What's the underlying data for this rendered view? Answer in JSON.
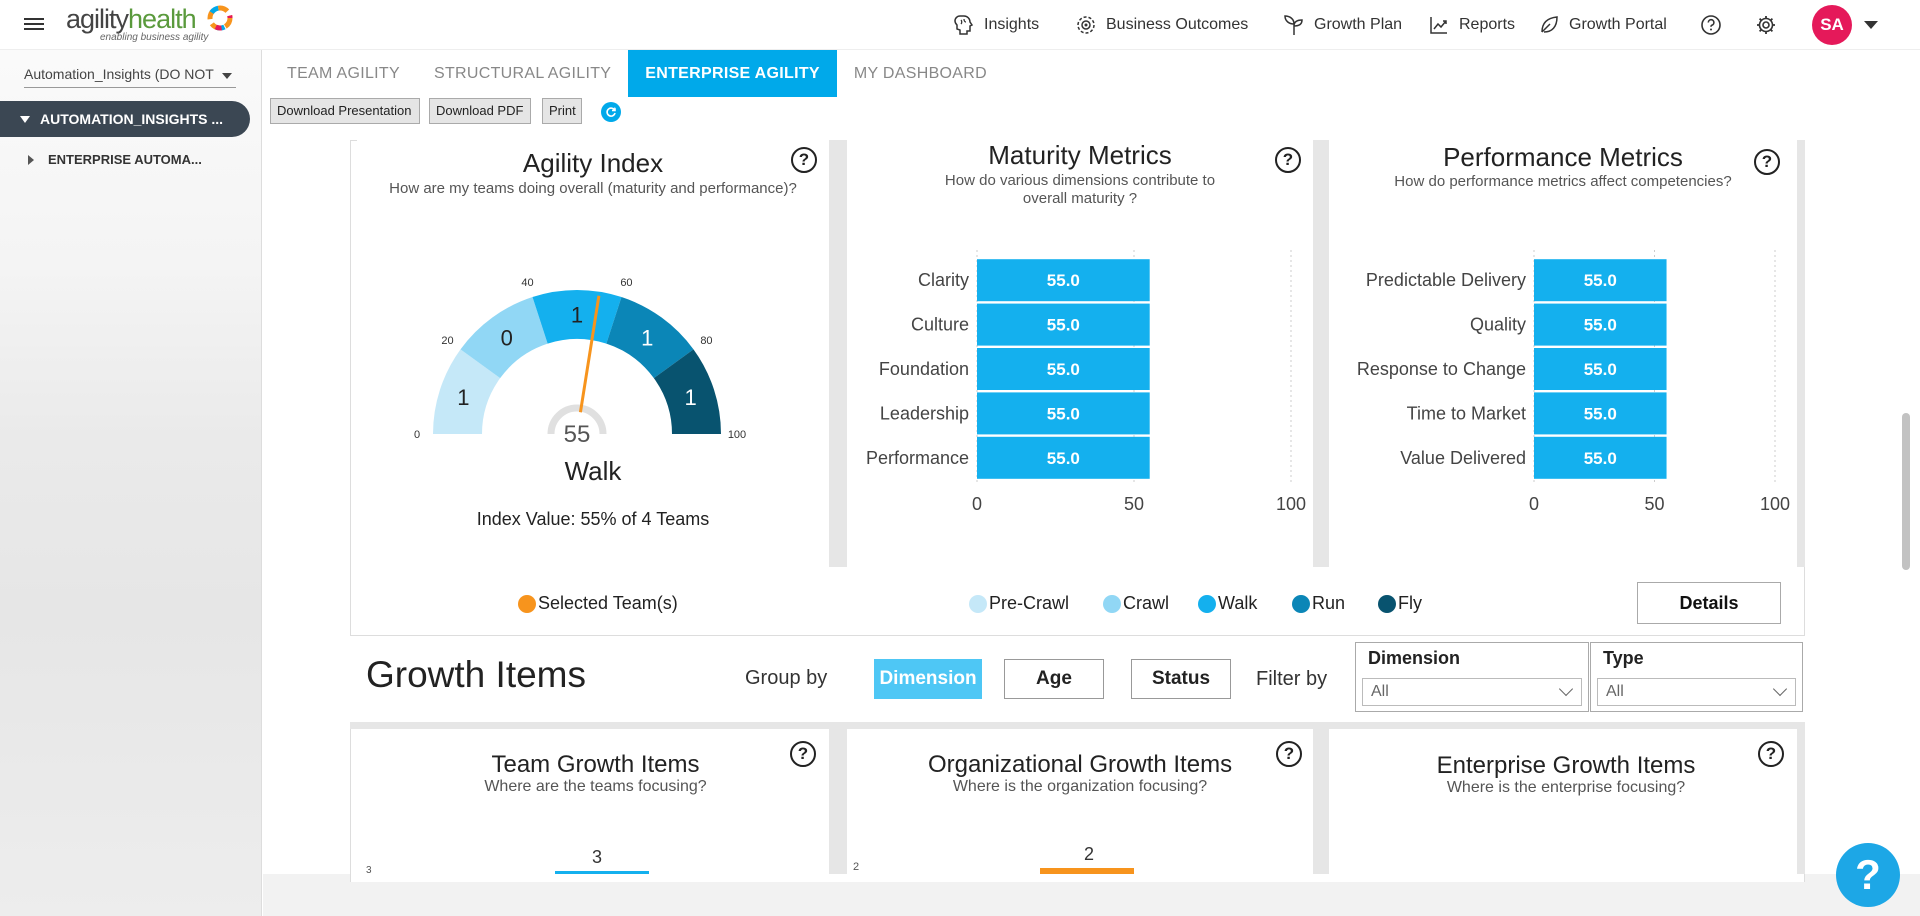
{
  "topbar": {
    "logo_brand": "agility",
    "logo_brand2": "health",
    "logo_tagline": "enabling business agility",
    "nav": [
      {
        "label": "Insights",
        "icon": "brain-icon"
      },
      {
        "label": "Business Outcomes",
        "icon": "target-icon"
      },
      {
        "label": "Growth Plan",
        "icon": "sprout-icon"
      },
      {
        "label": "Reports",
        "icon": "trend-chart-icon"
      },
      {
        "label": "Growth Portal",
        "icon": "leaf-icon"
      }
    ],
    "avatar_initials": "SA"
  },
  "sidebar": {
    "workspace_select": "Automation_Insights (DO NOT",
    "tree_root": "AUTOMATION_INSIGHTS ...",
    "tree_child": "ENTERPRISE AUTOMA..."
  },
  "tabs": [
    "TEAM AGILITY",
    "STRUCTURAL AGILITY",
    "ENTERPRISE AGILITY",
    "MY DASHBOARD"
  ],
  "toolbar": {
    "download_presentation": "Download Presentation",
    "download_pdf": "Download PDF",
    "print": "Print"
  },
  "agility_index": {
    "title": "Agility Index",
    "subtitle": "How are my teams doing overall (maturity and performance)?",
    "gauge_value": 55,
    "gauge_min": 0,
    "gauge_max": 100,
    "tick_labels": [
      "0",
      "20",
      "40",
      "60",
      "80",
      "100"
    ],
    "segments": [
      {
        "stage": "Pre-Crawl",
        "count": "1",
        "color": "#c5e8f8"
      },
      {
        "stage": "Crawl",
        "count": "0",
        "color": "#91d7f5"
      },
      {
        "stage": "Walk",
        "count": "1",
        "color": "#14b0ee"
      },
      {
        "stage": "Run",
        "count": "1",
        "color": "#0b86b7"
      },
      {
        "stage": "Fly",
        "count": "1",
        "color": "#08536f"
      }
    ],
    "level": "Walk",
    "index_text": "Index Value: 55% of 4 Teams"
  },
  "maturity_metrics": {
    "title": "Maturity Metrics",
    "subtitle_line1": "How do various dimensions contribute to",
    "subtitle_line2": "overall maturity ?"
  },
  "performance_metrics": {
    "title": "Performance Metrics",
    "subtitle": "How do performance metrics affect competencies?"
  },
  "legend": {
    "selected": "Selected Team(s)",
    "selected_color": "#f7941d",
    "stages": [
      {
        "label": "Pre-Crawl",
        "color": "#c5e8f8"
      },
      {
        "label": "Crawl",
        "color": "#91d7f5"
      },
      {
        "label": "Walk",
        "color": "#14b0ee"
      },
      {
        "label": "Run",
        "color": "#0b86b7"
      },
      {
        "label": "Fly",
        "color": "#08536f"
      }
    ]
  },
  "details_button": "Details",
  "growth_items": {
    "title": "Growth Items",
    "group_by_label": "Group by",
    "group_buttons": [
      "Dimension",
      "Age",
      "Status"
    ],
    "filter_by_label": "Filter by",
    "filters": [
      {
        "label": "Dimension",
        "value": "All"
      },
      {
        "label": "Type",
        "value": "All"
      }
    ],
    "panels": [
      {
        "title": "Team Growth Items",
        "subtitle": "Where are the teams focusing?",
        "axis_tick": "3",
        "bar_label": "3"
      },
      {
        "title": "Organizational Growth Items",
        "subtitle": "Where is the organization focusing?",
        "axis_tick": "2",
        "bar_label": "2"
      },
      {
        "title": "Enterprise Growth Items",
        "subtitle": "Where is the enterprise focusing?"
      }
    ]
  },
  "help_fab": "?",
  "chart_data": [
    {
      "type": "bar",
      "orientation": "horizontal",
      "title": "Maturity Metrics",
      "categories": [
        "Clarity",
        "Culture",
        "Foundation",
        "Leadership",
        "Performance"
      ],
      "values": [
        55.0,
        55.0,
        55.0,
        55.0,
        55.0
      ],
      "xlim": [
        0,
        100
      ],
      "x_ticks": [
        "0",
        "50",
        "100"
      ],
      "bar_color": "#14b0ee",
      "grid": true
    },
    {
      "type": "bar",
      "orientation": "horizontal",
      "title": "Performance Metrics",
      "categories": [
        "Predictable Delivery",
        "Quality",
        "Response to Change",
        "Time to Market",
        "Value Delivered"
      ],
      "values": [
        55.0,
        55.0,
        55.0,
        55.0,
        55.0
      ],
      "xlim": [
        0,
        100
      ],
      "x_ticks": [
        "0",
        "50",
        "100"
      ],
      "bar_color": "#14b0ee",
      "grid": true
    }
  ]
}
